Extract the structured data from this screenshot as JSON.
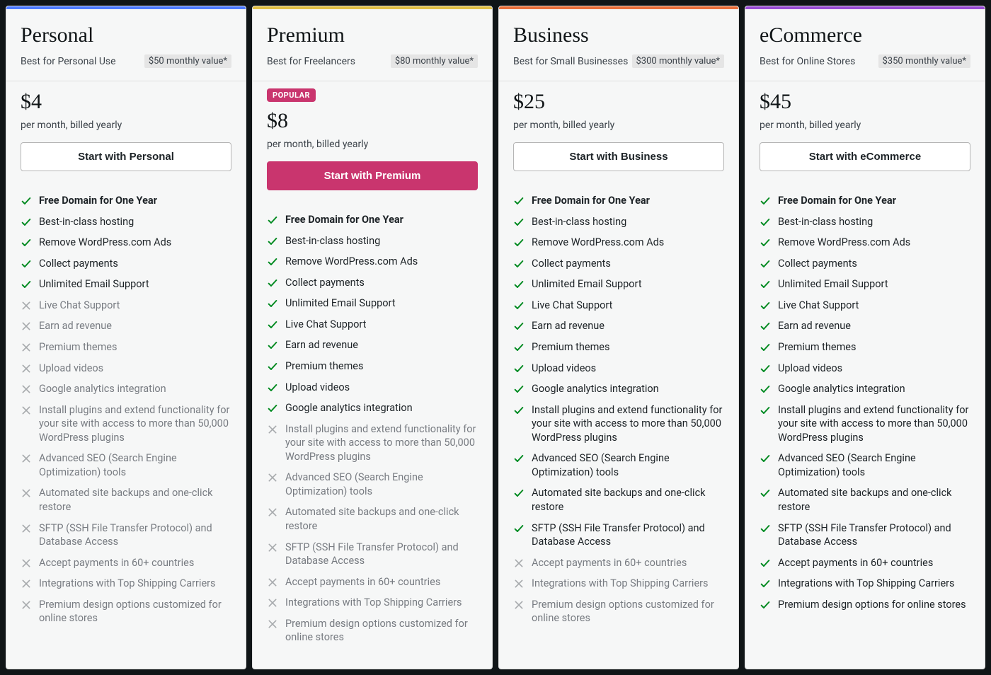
{
  "featureLabels": [
    "Free Domain for One Year",
    "Best-in-class hosting",
    "Remove WordPress.com Ads",
    "Collect payments",
    "Unlimited Email Support",
    "Live Chat Support",
    "Earn ad revenue",
    "Premium themes",
    "Upload videos",
    "Google analytics integration",
    "Install plugins and extend functionality for your site with access to more than 50,000 WordPress plugins",
    "Advanced SEO (Search Engine Optimization) tools",
    "Automated site backups and one-click restore",
    "SFTP (SSH File Transfer Protocol) and Database Access",
    "Accept payments in 60+ countries",
    "Integrations with Top Shipping Carriers",
    "Premium design options customized for online stores"
  ],
  "ecommerceLastLabel": "Premium design options for online stores",
  "plans": [
    {
      "id": "personal",
      "name": "Personal",
      "tagline": "Best for Personal Use",
      "valueBadge": "$50 monthly value*",
      "price": "$4",
      "billing": "per month, billed yearly",
      "cta": "Start with Personal",
      "ctaStyle": "outline",
      "popular": false,
      "barColor": "#4d7bff",
      "included": [
        true,
        true,
        true,
        true,
        true,
        false,
        false,
        false,
        false,
        false,
        false,
        false,
        false,
        false,
        false,
        false,
        false
      ]
    },
    {
      "id": "premium",
      "name": "Premium",
      "tagline": "Best for Freelancers",
      "valueBadge": "$80 monthly value*",
      "price": "$8",
      "billing": "per month, billed yearly",
      "cta": "Start with Premium",
      "ctaStyle": "filled",
      "popular": true,
      "popularLabel": "POPULAR",
      "barColor": "#e0c045",
      "included": [
        true,
        true,
        true,
        true,
        true,
        true,
        true,
        true,
        true,
        true,
        false,
        false,
        false,
        false,
        false,
        false,
        false
      ]
    },
    {
      "id": "business",
      "name": "Business",
      "tagline": "Best for Small Businesses",
      "valueBadge": "$300 monthly value*",
      "price": "$25",
      "billing": "per month, billed yearly",
      "cta": "Start with Business",
      "ctaStyle": "outline",
      "popular": false,
      "barColor": "#e86f3a",
      "included": [
        true,
        true,
        true,
        true,
        true,
        true,
        true,
        true,
        true,
        true,
        true,
        true,
        true,
        true,
        false,
        false,
        false
      ]
    },
    {
      "id": "ecommerce",
      "name": "eCommerce",
      "tagline": "Best for Online Stores",
      "valueBadge": "$350 monthly value*",
      "price": "$45",
      "billing": "per month, billed yearly",
      "cta": "Start with eCommerce",
      "ctaStyle": "outline",
      "popular": false,
      "barColor": "#984dd4",
      "included": [
        true,
        true,
        true,
        true,
        true,
        true,
        true,
        true,
        true,
        true,
        true,
        true,
        true,
        true,
        true,
        true,
        true
      ]
    }
  ]
}
